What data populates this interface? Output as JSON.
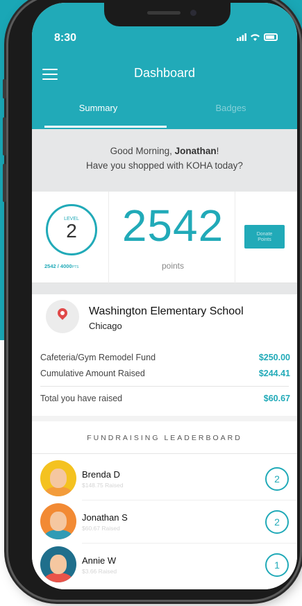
{
  "status_bar": {
    "time": "8:30"
  },
  "header": {
    "title": "Dashboard",
    "tabs": [
      {
        "label": "Summary",
        "active": true
      },
      {
        "label": "Badges",
        "active": false
      }
    ]
  },
  "greeting": {
    "line1_prefix": "Good Morning, ",
    "name": "Jonathan",
    "line1_suffix": "!",
    "line2": "Have you shopped with KOHA today?"
  },
  "points": {
    "level_label": "LEVEL",
    "level": "2",
    "progress_text": "2542 / 4000",
    "progress_unit": "PTS",
    "value": "2542",
    "label": "points",
    "donate_label_line1": "Donate",
    "donate_label_line2": "Points"
  },
  "school": {
    "name": "Washington Elementary School",
    "city": "Chicago",
    "rows": [
      {
        "label": "Cafeteria/Gym Remodel Fund",
        "amount": "$250.00"
      },
      {
        "label": "Cumulative Amount Raised",
        "amount": "$244.41"
      },
      {
        "label": "Total you have raised",
        "amount": "$60.67"
      }
    ]
  },
  "leaderboard": {
    "title": "FUNDRAISING LEADERBOARD",
    "entries": [
      {
        "name": "Brenda D",
        "raised": "$148.75 Raised",
        "rank": "2",
        "avatar_color": "#f4c220",
        "body_color": "#f39c3b"
      },
      {
        "name": "Jonathan S",
        "raised": "$60.67 Raised",
        "rank": "2",
        "avatar_color": "#f28a34",
        "body_color": "#2f9bb5"
      },
      {
        "name": "Annie W",
        "raised": "$3.66 Raised",
        "rank": "1",
        "avatar_color": "#1f6f8c",
        "body_color": "#e9544a"
      }
    ]
  },
  "colors": {
    "accent": "#21aab8",
    "page_bg_top": "#1aa7b6"
  }
}
